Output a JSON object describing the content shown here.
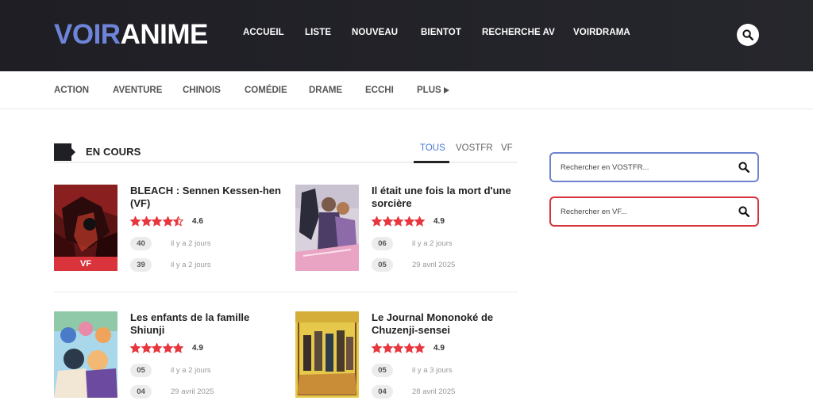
{
  "header": {
    "logo_part1": "VOIR",
    "logo_part2": "ANIME",
    "nav": [
      "ACCUEIL",
      "LISTE",
      "NOUVEAU",
      "BIENTOT",
      "RECHERCHE AV",
      "VOIRDRAMA"
    ],
    "search_icon": "search-icon"
  },
  "genres": {
    "items": [
      "ACTION",
      "AVENTURE",
      "CHINOIS",
      "COMÉDIE",
      "DRAME",
      "ECCHI"
    ],
    "more_label": "PLUS",
    "more_icon": "play-triangle-icon"
  },
  "section": {
    "title": "EN COURS",
    "tabs": [
      "TOUS",
      "VOSTFR",
      "VF"
    ],
    "active_tab": "TOUS"
  },
  "cards": [
    {
      "title": "BLEACH : Sennen Kessen-hen (VF)",
      "badge": "VF",
      "rating": "4.6",
      "stars": 4.6,
      "episodes": [
        {
          "num": "40",
          "date": "il y a 2 jours"
        },
        {
          "num": "39",
          "date": "il y a 2 jours"
        }
      ]
    },
    {
      "title": "Il était une fois la mort d'une sorcière",
      "badge": "",
      "rating": "4.9",
      "stars": 4.9,
      "episodes": [
        {
          "num": "06",
          "date": "il y a 2 jours"
        },
        {
          "num": "05",
          "date": "29 avril 2025"
        }
      ]
    },
    {
      "title": "Les enfants de la famille Shiunji",
      "badge": "",
      "rating": "4.9",
      "stars": 4.9,
      "episodes": [
        {
          "num": "05",
          "date": "il y a 2 jours"
        },
        {
          "num": "04",
          "date": "29 avril 2025"
        }
      ]
    },
    {
      "title": "Le Journal Mononoké de Chuzenji-sensei",
      "badge": "",
      "rating": "4.9",
      "stars": 4.9,
      "episodes": [
        {
          "num": "05",
          "date": "il y a 3 jours"
        },
        {
          "num": "04",
          "date": "28 avril 2025"
        }
      ]
    }
  ],
  "sidebar": {
    "search_vostfr_placeholder": "Rechercher en VOSTFR...",
    "search_vf_placeholder": "Rechercher en VF..."
  },
  "colors": {
    "header_bg": "#1e1e24",
    "logo_accent": "#6e84d8",
    "star": "#e8363e",
    "tab_active": "#4a7bd0",
    "vf_badge": "#d9343c",
    "vostfr_border": "#6d82d0",
    "vf_border": "#d6323b"
  }
}
